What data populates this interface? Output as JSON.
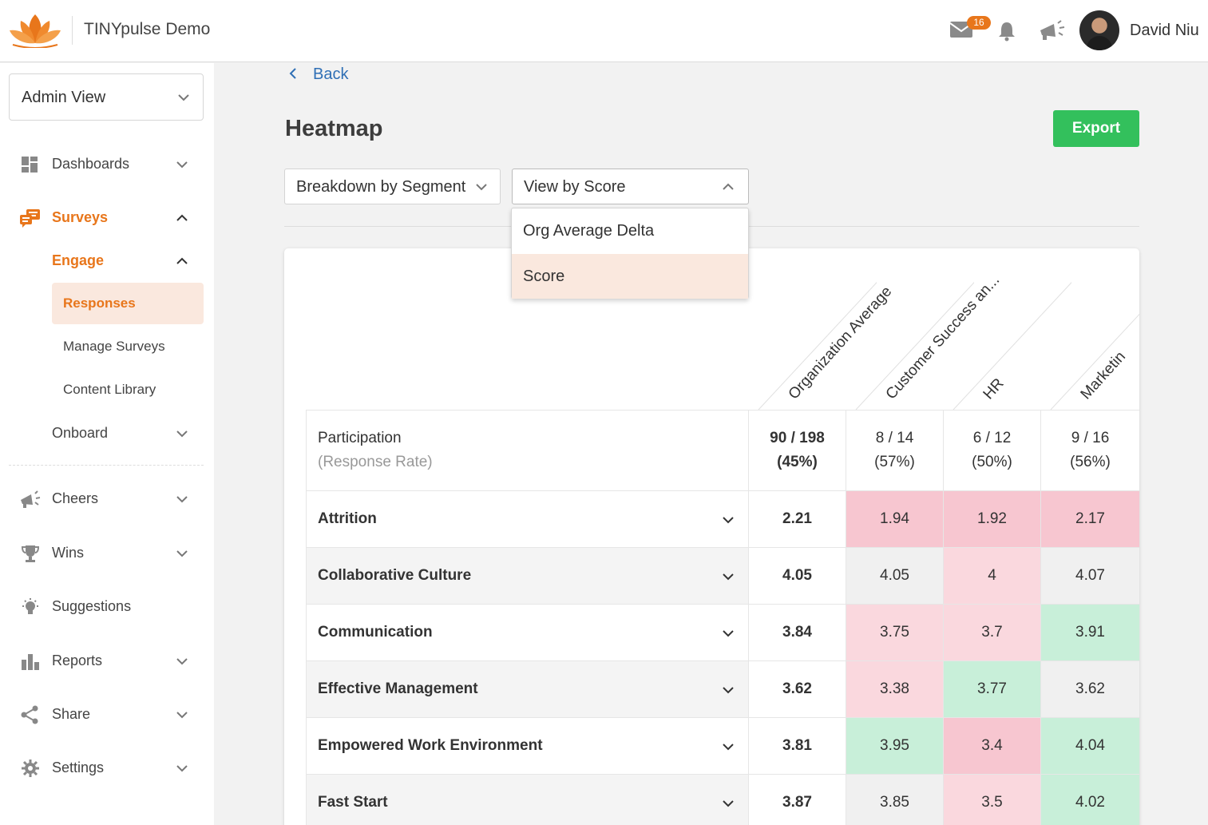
{
  "app": {
    "brand": "TINYpulse Demo"
  },
  "header": {
    "mail_count": "16",
    "user_name": "David Niu"
  },
  "sidebar": {
    "view_select": "Admin View",
    "items": [
      {
        "label": "Dashboards",
        "icon": "dashboard-icon"
      },
      {
        "label": "Surveys",
        "icon": "surveys-icon"
      },
      {
        "label": "Engage"
      },
      {
        "label": "Responses"
      },
      {
        "label": "Manage Surveys"
      },
      {
        "label": "Content Library"
      },
      {
        "label": "Onboard"
      },
      {
        "label": "Cheers",
        "icon": "megaphone-icon"
      },
      {
        "label": "Wins",
        "icon": "trophy-icon"
      },
      {
        "label": "Suggestions",
        "icon": "lightbulb-icon"
      },
      {
        "label": "Reports",
        "icon": "bar-chart-icon"
      },
      {
        "label": "Share",
        "icon": "share-icon"
      },
      {
        "label": "Settings",
        "icon": "gear-icon"
      }
    ]
  },
  "main": {
    "back_label": "Back",
    "title": "Heatmap",
    "export_label": "Export",
    "breakdown_select": "Breakdown by Segment",
    "view_select": "View by Score",
    "view_options": [
      "Org Average Delta",
      "Score"
    ],
    "view_selected": "Score"
  },
  "heatmap": {
    "columns": [
      "Organization Average",
      "Customer Success an...",
      "HR",
      "Marketin"
    ],
    "participation": {
      "label": "Participation",
      "sublabel": "(Response Rate)",
      "values": [
        {
          "count": "90 / 198",
          "rate": "(45%)"
        },
        {
          "count": "8 / 14",
          "rate": "(57%)"
        },
        {
          "count": "6 / 12",
          "rate": "(50%)"
        },
        {
          "count": "9 / 16",
          "rate": "(56%)"
        }
      ]
    },
    "rows": [
      {
        "label": "Attrition",
        "values": [
          "2.21",
          "1.94",
          "1.92",
          "2.17"
        ],
        "colors": [
          "org",
          "red",
          "red",
          "red"
        ]
      },
      {
        "label": "Collaborative Culture",
        "values": [
          "4.05",
          "4.05",
          "4",
          "4.07"
        ],
        "colors": [
          "org",
          "gray",
          "lred",
          "gray"
        ]
      },
      {
        "label": "Communication",
        "values": [
          "3.84",
          "3.75",
          "3.7",
          "3.91"
        ],
        "colors": [
          "org",
          "lred",
          "lred",
          "green"
        ]
      },
      {
        "label": "Effective Management",
        "values": [
          "3.62",
          "3.38",
          "3.77",
          "3.62"
        ],
        "colors": [
          "org",
          "lred",
          "green",
          "gray"
        ]
      },
      {
        "label": "Empowered Work Environment",
        "values": [
          "3.81",
          "3.95",
          "3.4",
          "4.04"
        ],
        "colors": [
          "org",
          "green",
          "red",
          "green"
        ]
      },
      {
        "label": "Fast Start",
        "values": [
          "3.87",
          "3.85",
          "3.5",
          "4.02"
        ],
        "colors": [
          "org",
          "gray",
          "lred",
          "green"
        ]
      }
    ],
    "color_legend": {
      "red": "#f7c6d0",
      "light_red": "#fad8de",
      "green": "#c8efd9",
      "neutral": "#f0f0f0"
    }
  },
  "colors": {
    "accent": "#e8761b",
    "export": "#33c05c",
    "link": "#2f6fb5"
  }
}
